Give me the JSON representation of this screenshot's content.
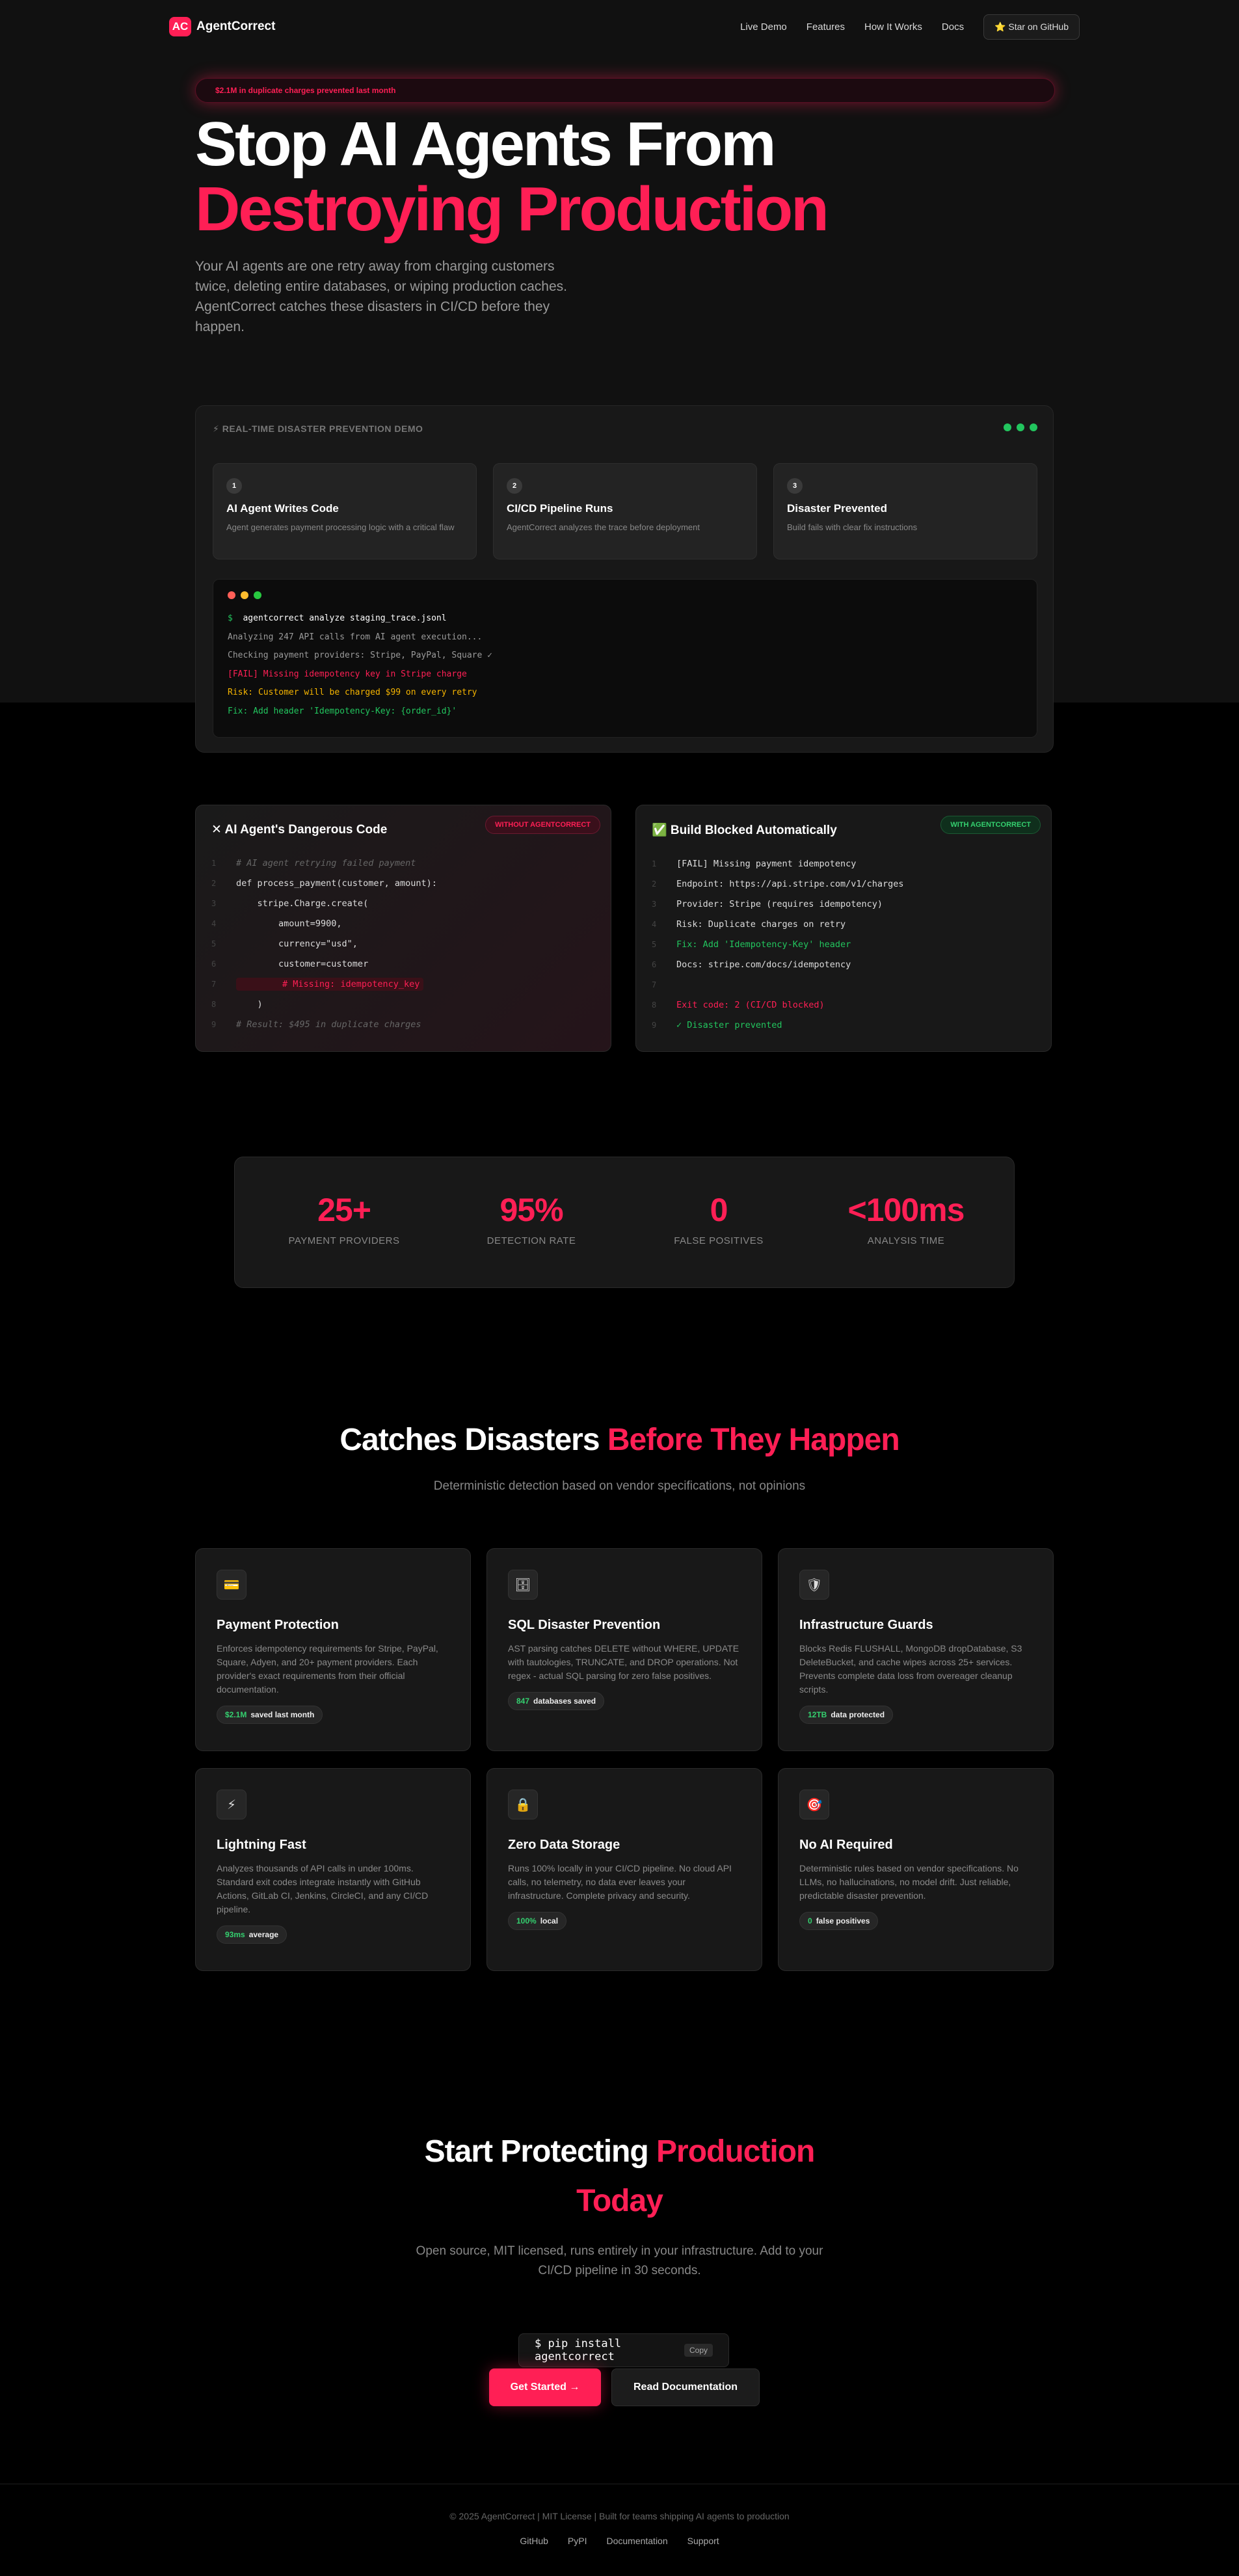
{
  "nav": {
    "logo_badge": "AC",
    "logo_text": "AgentCorrect",
    "links": [
      "Live Demo",
      "Features",
      "How It Works",
      "Docs"
    ],
    "github_button": "⭐ Star on GitHub"
  },
  "hero": {
    "pill": "$2.1M in duplicate charges prevented last month",
    "title_line1": "Stop AI Agents From",
    "title_line2": "Destroying Production",
    "lead": "Your AI agents are one retry away from charging customers twice, deleting entire databases, or wiping production caches. AgentCorrect catches these disasters in CI/CD before they happen."
  },
  "demo": {
    "title": "⚡ REAL-TIME DISASTER PREVENTION DEMO",
    "steps": [
      {
        "num": "1",
        "title": "AI Agent Writes Code",
        "desc": "Agent generates payment processing logic with a critical flaw"
      },
      {
        "num": "2",
        "title": "CI/CD Pipeline Runs",
        "desc": "AgentCorrect analyzes the trace before deployment"
      },
      {
        "num": "3",
        "title": "Disaster Prevented",
        "desc": "Build fails with clear fix instructions"
      }
    ],
    "terminal": {
      "prompt": "$",
      "command": "agentcorrect analyze staging_trace.jsonl",
      "lines": [
        {
          "text": "Analyzing 247 API calls from AI agent execution...",
          "color": "#9a9a9a"
        },
        {
          "text": "Checking payment providers: Stripe, PayPal, Square ✓",
          "color": "#9a9a9a"
        },
        {
          "text": "[FAIL] Missing idempotency key in Stripe charge",
          "color": "#ff1f55"
        },
        {
          "text": "Risk: Customer will be charged $99 on every retry",
          "color": "#f5b400"
        },
        {
          "text": "Fix: Add header 'Idempotency-Key: {order_id}'",
          "color": "#22c55e"
        }
      ]
    }
  },
  "code_left": {
    "title": "✕ AI Agent's Dangerous Code",
    "badge": "WITHOUT AGENTCORRECT",
    "lines": [
      {
        "n": "1",
        "text": "# AI agent retrying failed payment",
        "style": "comment"
      },
      {
        "n": "2",
        "text": "def process_payment(customer, amount):",
        "style": "def"
      },
      {
        "n": "3",
        "text": "    stripe.Charge.create(",
        "style": "call"
      },
      {
        "n": "4",
        "text": "        amount=9900,",
        "style": "num"
      },
      {
        "n": "5",
        "text": "        currency=\"usd\",",
        "style": "str"
      },
      {
        "n": "6",
        "text": "        customer=customer",
        "style": "plain"
      },
      {
        "n": "7",
        "text": "        # Missing: idempotency_key",
        "style": "danger"
      },
      {
        "n": "8",
        "text": "    )",
        "style": "plain"
      },
      {
        "n": "9",
        "text": "# Result: $495 in duplicate charges",
        "style": "comment"
      }
    ]
  },
  "code_right": {
    "title": "✅ Build Blocked Automatically",
    "badge": "WITH AGENTCORRECT",
    "lines": [
      {
        "n": "1",
        "text": "[FAIL] Missing payment idempotency",
        "style": "fail"
      },
      {
        "n": "2",
        "text": "Endpoint: https://api.stripe.com/v1/charges",
        "style": "plain"
      },
      {
        "n": "3",
        "text": "Provider: Stripe (requires idempotency)",
        "style": "plain"
      },
      {
        "n": "4",
        "text": "Risk: Duplicate charges on retry",
        "style": "plain"
      },
      {
        "n": "5",
        "text": "Fix: Add 'Idempotency-Key' header",
        "style": "green"
      },
      {
        "n": "6",
        "text": "Docs: stripe.com/docs/idempotency",
        "style": "plain"
      },
      {
        "n": "7",
        "text": "",
        "style": "plain"
      },
      {
        "n": "8",
        "text": "Exit code: 2 (CI/CD blocked)",
        "style": "red"
      },
      {
        "n": "9",
        "text": "✓ Disaster prevented",
        "style": "green"
      }
    ]
  },
  "stats": [
    {
      "value": "25+",
      "label": "PAYMENT PROVIDERS"
    },
    {
      "value": "95%",
      "label": "DETECTION RATE"
    },
    {
      "value": "0",
      "label": "FALSE POSITIVES"
    },
    {
      "value": "<100ms",
      "label": "ANALYSIS TIME"
    }
  ],
  "features": {
    "title_a": "Catches Disasters ",
    "title_b": "Before They Happen",
    "subtitle": "Deterministic detection based on vendor specifications, not opinions",
    "cards": [
      {
        "icon": "💳",
        "icon_name": "credit-card-icon",
        "title": "Payment Protection",
        "desc": "Enforces idempotency requirements for Stripe, PayPal, Square, Adyen, and 20+ payment providers. Each provider's exact requirements from their official documentation.",
        "badge_num": "$2.1M",
        "badge_text": "saved last month"
      },
      {
        "icon": "🗄",
        "icon_name": "database-icon",
        "title": "SQL Disaster Prevention",
        "desc": "AST parsing catches DELETE without WHERE, UPDATE with tautologies, TRUNCATE, and DROP operations. Not regex - actual SQL parsing for zero false positives.",
        "badge_num": "847",
        "badge_text": "databases saved"
      },
      {
        "icon": "🛡",
        "icon_name": "shield-icon",
        "title": "Infrastructure Guards",
        "desc": "Blocks Redis FLUSHALL, MongoDB dropDatabase, S3 DeleteBucket, and cache wipes across 25+ services. Prevents complete data loss from overeager cleanup scripts.",
        "badge_num": "12TB",
        "badge_text": "data protected"
      },
      {
        "icon": "⚡",
        "icon_name": "lightning-icon",
        "title": "Lightning Fast",
        "desc": "Analyzes thousands of API calls in under 100ms. Standard exit codes integrate instantly with GitHub Actions, GitLab CI, Jenkins, CircleCI, and any CI/CD pipeline.",
        "badge_num": "93ms",
        "badge_text": "average"
      },
      {
        "icon": "🔒",
        "icon_name": "lock-icon",
        "title": "Zero Data Storage",
        "desc": "Runs 100% locally in your CI/CD pipeline. No cloud API calls, no telemetry, no data ever leaves your infrastructure. Complete privacy and security.",
        "badge_num": "100%",
        "badge_text": "local"
      },
      {
        "icon": "🎯",
        "icon_name": "target-icon",
        "title": "No AI Required",
        "desc": "Deterministic rules based on vendor specifications. No LLMs, no hallucinations, no model drift. Just reliable, predictable disaster prevention.",
        "badge_num": "0",
        "badge_text": "false positives"
      }
    ]
  },
  "cta": {
    "line1_a": "Start Protecting ",
    "line1_b": "Production",
    "line2": "Today",
    "subtitle": "Open source, MIT licensed, runs entirely in your infrastructure. Add to your CI/CD pipeline in 30 seconds.",
    "pip": "$ pip install agentcorrect",
    "copy": "Copy",
    "primary": "Get Started →",
    "secondary": "Read Documentation"
  },
  "footer": {
    "copy": "© 2025 AgentCorrect | MIT License | Built for teams shipping AI agents to production",
    "links": [
      "GitHub",
      "PyPI",
      "Documentation",
      "Support"
    ]
  },
  "colors": {
    "accent": "#ff1f55",
    "success": "#22c55e",
    "warning": "#f5b400",
    "bg": "#000000"
  }
}
